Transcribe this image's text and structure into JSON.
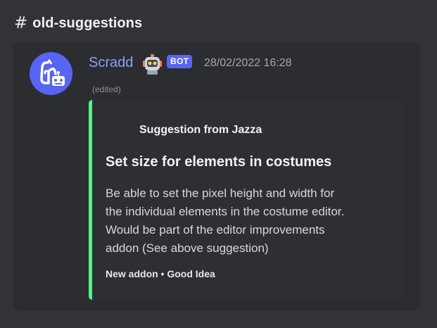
{
  "channel": {
    "name": "old-suggestions"
  },
  "message": {
    "username": "Scradd",
    "bot_tag": "BOT",
    "timestamp": "28/02/2022 16:28",
    "edited_label": "(edited)",
    "embed": {
      "author": "Suggestion from Jazza",
      "title": "Set size for elements in costumes",
      "description_lines": [
        "Be able to set the pixel height and width for",
        "the individual elements in the costume editor.",
        "Would be part of the editor improvements",
        "addon (See above suggestion)"
      ],
      "footer": "New addon • Good Idea",
      "accent_color": "#57f287"
    }
  },
  "colors": {
    "background": "#313338",
    "card": "#2b2d31",
    "username": "#949cf7",
    "bot_tag": "#5865f2",
    "avatar": "#5865f2"
  },
  "icons": {
    "channel": "hash-icon",
    "avatar": "scradd-avatar",
    "robot_emoji": "robot-icon"
  }
}
